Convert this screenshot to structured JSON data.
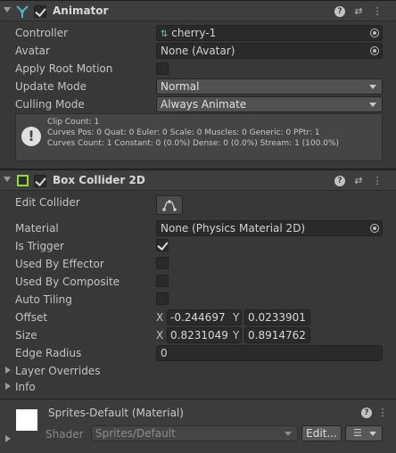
{
  "animator": {
    "title": "Animator",
    "enabled": true,
    "rows": {
      "controller_label": "Controller",
      "controller_value": "cherry-1",
      "avatar_label": "Avatar",
      "avatar_value": "None (Avatar)",
      "apply_root_motion_label": "Apply Root Motion",
      "update_mode_label": "Update Mode",
      "update_mode_value": "Normal",
      "culling_mode_label": "Culling Mode",
      "culling_mode_value": "Always Animate"
    },
    "info": {
      "line1": "Clip Count: 1",
      "line2": "Curves Pos: 0 Quat: 0 Euler: 0 Scale: 0 Muscles: 0 Generic: 0 PPtr: 1",
      "line3": "Curves Count: 1 Constant: 0 (0.0%) Dense: 0 (0.0%) Stream: 1 (100.0%)"
    }
  },
  "box_collider": {
    "title": "Box Collider 2D",
    "enabled": true,
    "edit_collider_label": "Edit Collider",
    "material_label": "Material",
    "material_value": "None (Physics Material 2D)",
    "is_trigger_label": "Is Trigger",
    "used_by_effector_label": "Used By Effector",
    "used_by_composite_label": "Used By Composite",
    "auto_tiling_label": "Auto Tiling",
    "offset_label": "Offset",
    "offset_x": "-0.244697",
    "offset_y": "0.0233901",
    "size_label": "Size",
    "size_x": "0.8231049",
    "size_y": "0.8914762",
    "edge_radius_label": "Edge Radius",
    "edge_radius_value": "0",
    "layer_overrides_label": "Layer Overrides",
    "info_label": "Info",
    "x_label": "X",
    "y_label": "Y"
  },
  "material": {
    "title": "Sprites-Default (Material)",
    "shader_label": "Shader",
    "shader_value": "Sprites/Default",
    "edit_button": "Edit..."
  },
  "colors": {
    "background": "#383838",
    "header": "#3e3e3e",
    "field": "#2a2a2a",
    "animator_icon": "#4fb4c8",
    "collider_icon": "#8fdc3c"
  },
  "icons": {
    "animator": "animator-icon",
    "collider": "box-collider-icon",
    "help": "help-icon",
    "presets": "presets-icon",
    "menu": "kebab-menu-icon"
  }
}
